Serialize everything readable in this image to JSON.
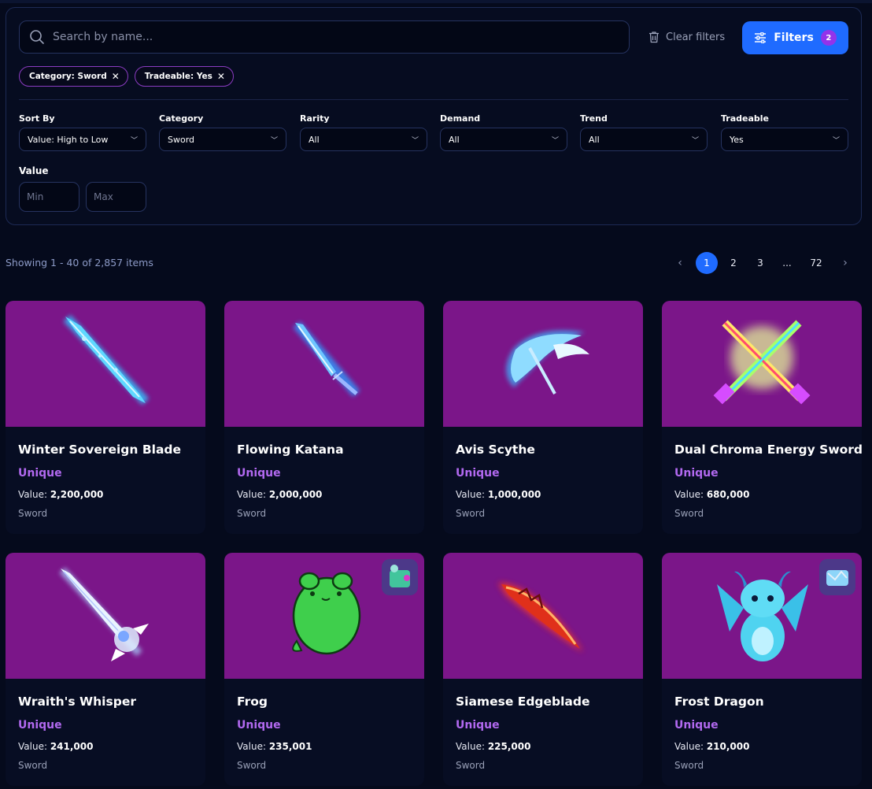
{
  "search": {
    "placeholder": "Search by name..."
  },
  "actions": {
    "clear_label": "Clear filters",
    "filters_label": "Filters",
    "filters_count": "2"
  },
  "active_filters": [
    {
      "label": "Category: Sword"
    },
    {
      "label": "Tradeable: Yes"
    }
  ],
  "filters": [
    {
      "label": "Sort By",
      "value": "Value: High to Low"
    },
    {
      "label": "Category",
      "value": "Sword"
    },
    {
      "label": "Rarity",
      "value": "All"
    },
    {
      "label": "Demand",
      "value": "All"
    },
    {
      "label": "Trend",
      "value": "All"
    },
    {
      "label": "Tradeable",
      "value": "Yes"
    }
  ],
  "value_filter": {
    "label": "Value",
    "min_placeholder": "Min",
    "max_placeholder": "Max"
  },
  "results": {
    "showing": "Showing 1 - 40 of 2,857 items"
  },
  "pagination": {
    "prev": "‹",
    "pages": [
      "1",
      "2",
      "3",
      "...",
      "72"
    ],
    "next": "›",
    "current": "1"
  },
  "value_prefix": "Value:",
  "colors": {
    "accent": "#1f6bff",
    "card_image_bg": "#7b1689",
    "rarity": "#b269f0"
  },
  "items": [
    {
      "name": "Winter Sovereign Blade",
      "rarity": "Unique",
      "value": "2,200,000",
      "category": "Sword",
      "icon": "ice-blade-icon"
    },
    {
      "name": "Flowing Katana",
      "rarity": "Unique",
      "value": "2,000,000",
      "category": "Sword",
      "icon": "katana-icon"
    },
    {
      "name": "Avis Scythe",
      "rarity": "Unique",
      "value": "1,000,000",
      "category": "Sword",
      "icon": "scythe-icon"
    },
    {
      "name": "Dual Chroma Energy Sword",
      "rarity": "Unique",
      "value": "680,000",
      "category": "Sword",
      "icon": "crossed-swords-icon"
    },
    {
      "name": "Wraith's Whisper",
      "rarity": "Unique",
      "value": "241,000",
      "category": "Sword",
      "icon": "wraith-blade-icon"
    },
    {
      "name": "Frog",
      "rarity": "Unique",
      "value": "235,001",
      "category": "Sword",
      "icon": "frog-icon"
    },
    {
      "name": "Siamese Edgeblade",
      "rarity": "Unique",
      "value": "225,000",
      "category": "Sword",
      "icon": "fire-blade-icon"
    },
    {
      "name": "Frost Dragon",
      "rarity": "Unique",
      "value": "210,000",
      "category": "Sword",
      "icon": "dragon-icon"
    }
  ]
}
